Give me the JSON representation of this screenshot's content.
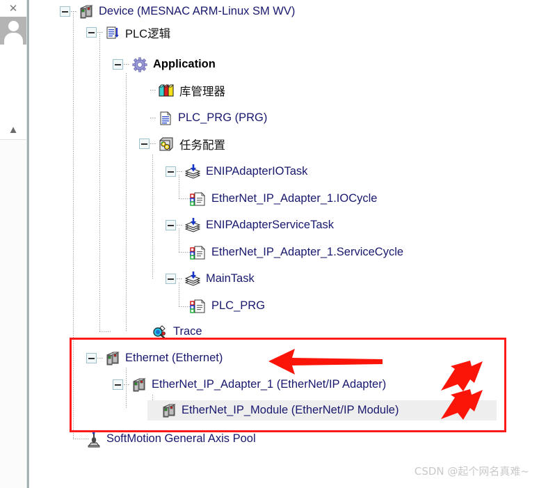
{
  "sidebar": {
    "close_icon": "close-icon",
    "avatar_icon": "avatar-icon",
    "collapse_icon": "chevron-up-icon"
  },
  "tree": {
    "nodes": [
      {
        "label": "Device (MESNAC ARM-Linux SM WV)",
        "icon": "device-icon",
        "depth": 0,
        "expander": "minus",
        "bold": false,
        "selected": false
      },
      {
        "label": "PLC逻辑",
        "icon": "plc-logic-icon",
        "depth": 1,
        "expander": "minus",
        "bold": false,
        "selected": false
      },
      {
        "label": "Application",
        "icon": "application-icon",
        "depth": 2,
        "expander": "minus",
        "bold": true,
        "selected": false
      },
      {
        "label": "库管理器",
        "icon": "library-manager-icon",
        "depth": 3,
        "expander": "none",
        "bold": false,
        "selected": false
      },
      {
        "label": "PLC_PRG (PRG)",
        "icon": "pou-icon",
        "depth": 3,
        "expander": "none",
        "bold": false,
        "selected": false
      },
      {
        "label": "任务配置",
        "icon": "task-config-icon",
        "depth": 3,
        "expander": "minus",
        "bold": false,
        "selected": false
      },
      {
        "label": "ENIPAdapterIOTask",
        "icon": "task-icon",
        "depth": 4,
        "expander": "minus",
        "bold": false,
        "selected": false
      },
      {
        "label": "EtherNet_IP_Adapter_1.IOCycle",
        "icon": "task-call-icon",
        "depth": 5,
        "expander": "none",
        "bold": false,
        "selected": false
      },
      {
        "label": "ENIPAdapterServiceTask",
        "icon": "task-icon",
        "depth": 4,
        "expander": "minus",
        "bold": false,
        "selected": false
      },
      {
        "label": "EtherNet_IP_Adapter_1.ServiceCycle",
        "icon": "task-call-icon",
        "depth": 5,
        "expander": "none",
        "bold": false,
        "selected": false
      },
      {
        "label": "MainTask",
        "icon": "task-icon",
        "depth": 4,
        "expander": "minus",
        "bold": false,
        "selected": false
      },
      {
        "label": "PLC_PRG",
        "icon": "task-call-icon",
        "depth": 5,
        "expander": "none",
        "bold": false,
        "selected": false
      },
      {
        "label": "Trace",
        "icon": "trace-icon",
        "depth": 3,
        "expander": "none",
        "bold": false,
        "selected": false
      },
      {
        "label": "Ethernet (Ethernet)",
        "icon": "device-icon",
        "depth": 1,
        "expander": "minus",
        "bold": false,
        "selected": false
      },
      {
        "label": "EtherNet_IP_Adapter_1 (EtherNet/IP Adapter)",
        "icon": "device-icon",
        "depth": 2,
        "expander": "minus",
        "bold": false,
        "selected": false
      },
      {
        "label": "EtherNet_IP_Module (EtherNet/IP Module)",
        "icon": "device-icon",
        "depth": 3,
        "expander": "none",
        "bold": false,
        "selected": true
      },
      {
        "label": "SoftMotion General Axis Pool",
        "icon": "axis-pool-icon",
        "depth": 1,
        "expander": "none",
        "bold": false,
        "selected": false
      }
    ]
  },
  "annotations": {
    "highlight_color": "#ff1a1a",
    "box_label": "highlight-rectangle",
    "arrows": [
      {
        "name": "arrow-ethernet",
        "direction": "left"
      },
      {
        "name": "arrow-adapter",
        "direction": "down-left"
      },
      {
        "name": "arrow-module",
        "direction": "down-left"
      }
    ]
  },
  "watermark": {
    "text": "CSDN @起个网名真难~"
  }
}
